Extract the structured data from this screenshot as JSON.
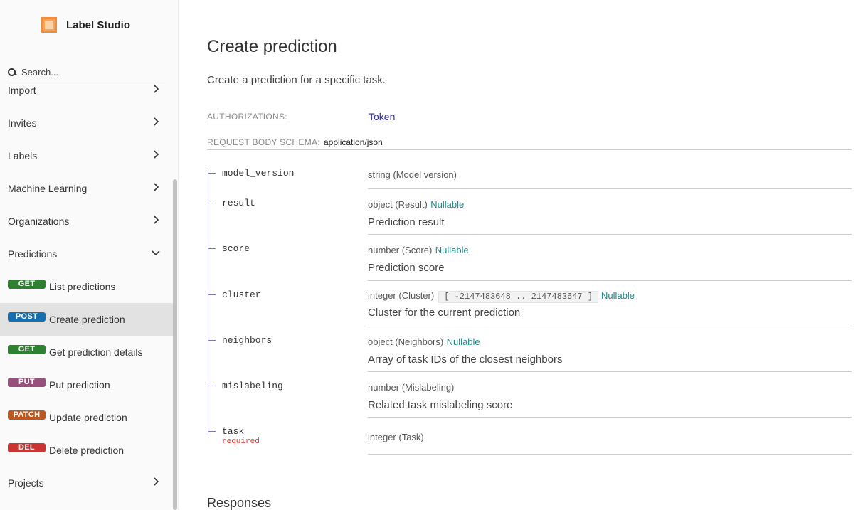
{
  "app": {
    "name": "Label Studio"
  },
  "search": {
    "placeholder": "Search..."
  },
  "sidebar": {
    "items": [
      {
        "label": "Import"
      },
      {
        "label": "Invites"
      },
      {
        "label": "Labels"
      },
      {
        "label": "Machine Learning"
      },
      {
        "label": "Organizations"
      },
      {
        "label": "Predictions"
      },
      {
        "method": "GET",
        "label": "List predictions"
      },
      {
        "method": "POST",
        "label": "Create prediction"
      },
      {
        "method": "GET",
        "label": "Get prediction details"
      },
      {
        "method": "PUT",
        "label": "Put prediction"
      },
      {
        "method": "PATCH",
        "label": "Update prediction"
      },
      {
        "method": "DEL",
        "label": "Delete prediction"
      },
      {
        "label": "Projects"
      }
    ]
  },
  "main": {
    "title": "Create prediction",
    "description": "Create a prediction for a specific task.",
    "auth_label": "AUTHORIZATIONS:",
    "auth_value": "Token",
    "schema_label": "REQUEST BODY SCHEMA:",
    "schema_value": "application/json",
    "properties": [
      {
        "name": "model_version",
        "type": "string (Model version)"
      },
      {
        "name": "result",
        "type": "object (Result)",
        "nullable": "Nullable",
        "description": "Prediction result"
      },
      {
        "name": "score",
        "type": "number (Score)",
        "nullable": "Nullable",
        "description": "Prediction score"
      },
      {
        "name": "cluster",
        "type": "integer (Cluster)",
        "range": "[ -2147483648 .. 2147483647 ]",
        "nullable": "Nullable",
        "description": "Cluster for the current prediction"
      },
      {
        "name": "neighbors",
        "type": "object (Neighbors)",
        "nullable": "Nullable",
        "description": "Array of task IDs of the closest neighbors"
      },
      {
        "name": "mislabeling",
        "type": "number (Mislabeling)",
        "description": "Related task mislabeling score"
      },
      {
        "name": "task",
        "type": "integer (Task)",
        "required": "required"
      }
    ],
    "responses_title": "Responses"
  }
}
